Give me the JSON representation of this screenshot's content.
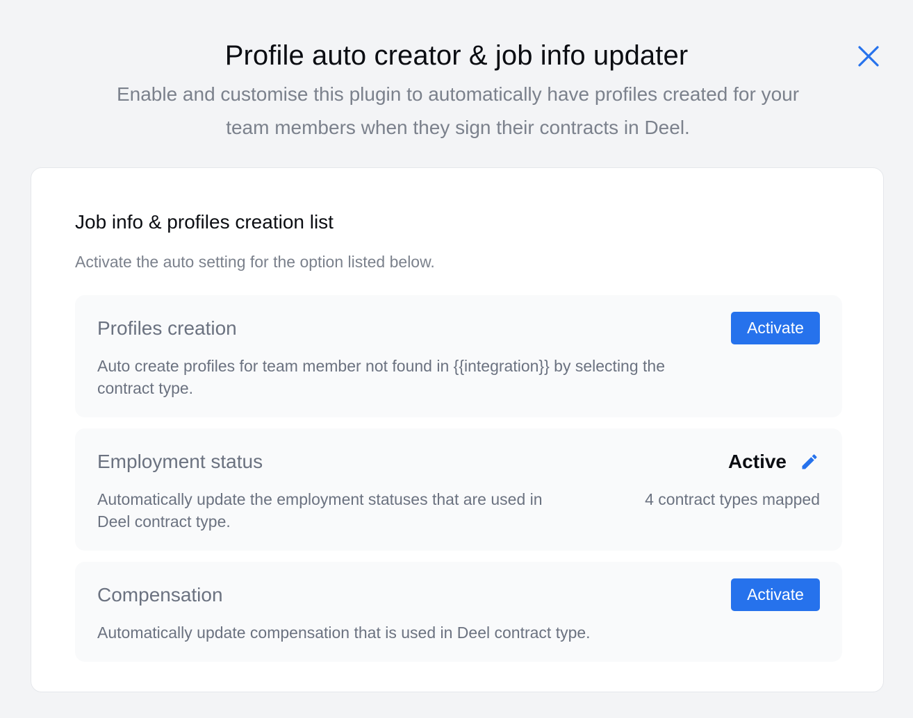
{
  "modal": {
    "title": "Profile auto creator & job info updater",
    "subtitle": "Enable and customise this plugin to automatically have profiles created for your team members when they sign their contracts in Deel.",
    "close_icon": "close-icon"
  },
  "section": {
    "title": "Job info & profiles creation list",
    "description": "Activate the auto setting for the option listed below."
  },
  "options": [
    {
      "title": "Profiles creation",
      "description": "Auto create profiles for team member not found in {{integration}} by selecting the contract type.",
      "action_label": "Activate"
    },
    {
      "title": "Employment status",
      "description": "Automatically update the employment statuses that are used in Deel contract type.",
      "status_label": "Active",
      "status_detail": "4 contract types mapped",
      "edit_icon": "pencil-icon"
    },
    {
      "title": "Compensation",
      "description": "Automatically update compensation that is used in Deel contract type.",
      "action_label": "Activate"
    }
  ],
  "colors": {
    "accent": "#2672ec",
    "background": "#f3f4f6",
    "card": "#ffffff",
    "option_bg": "#f9fafb",
    "muted_text": "#6b7280",
    "strong_text": "#0b0d12"
  }
}
